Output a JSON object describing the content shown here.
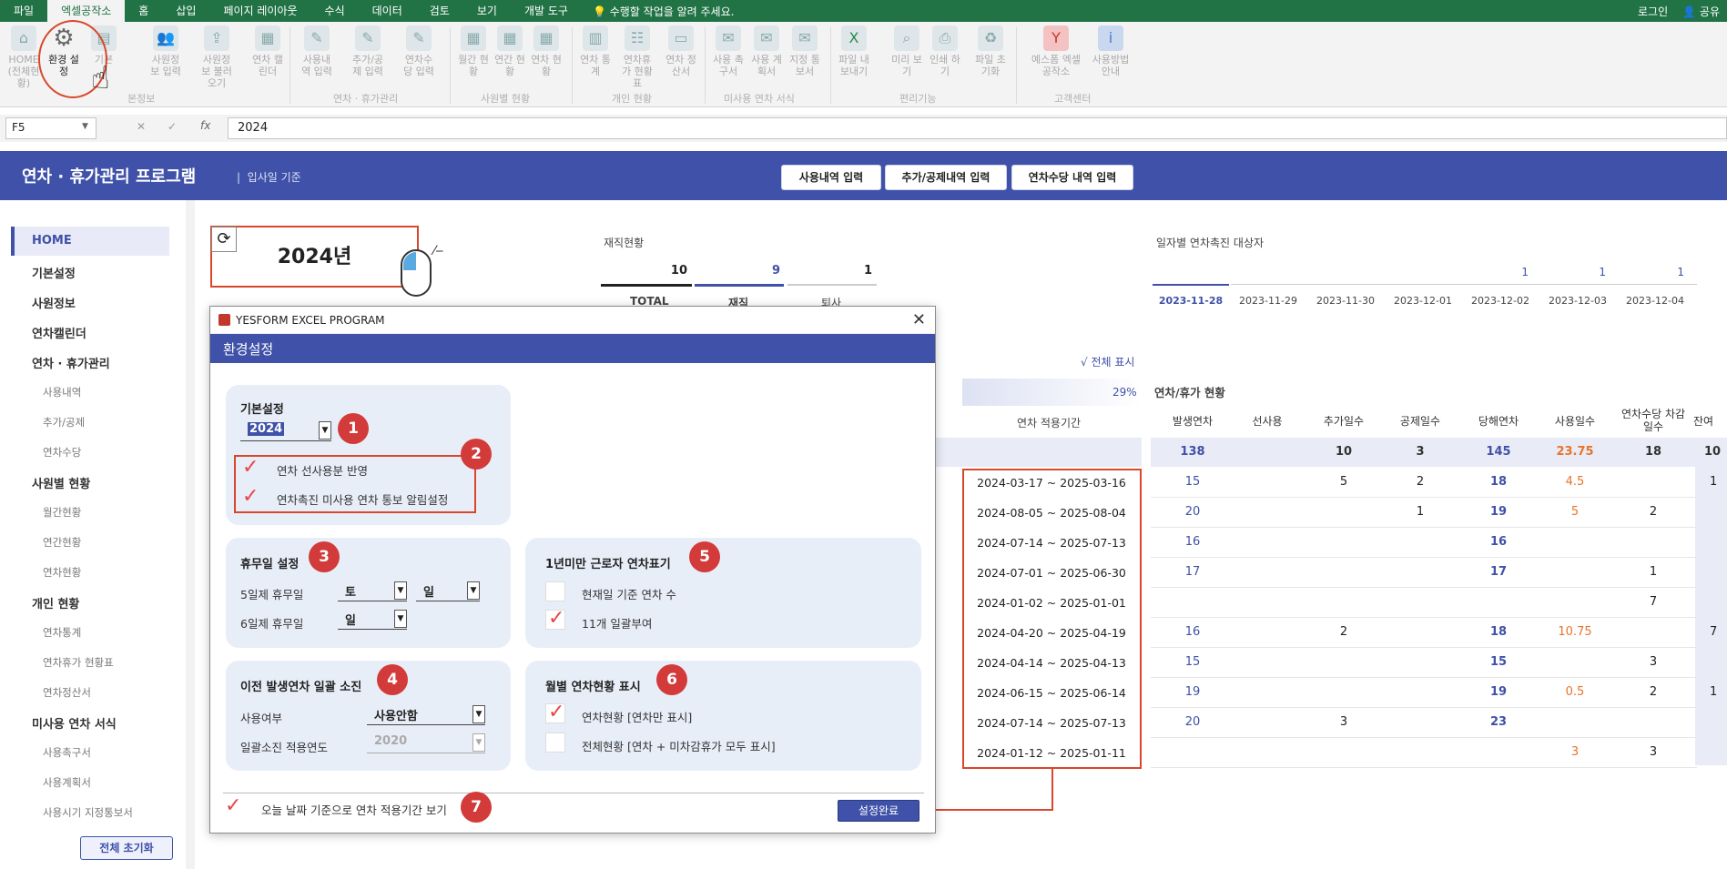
{
  "tabs": [
    "파일",
    "엑셀공작소",
    "홈",
    "삽입",
    "페이지 레이아웃",
    "수식",
    "데이터",
    "검토",
    "보기",
    "개발 도구"
  ],
  "tellme": "수행할 작업을 알려 주세요.",
  "login": "로그인",
  "share": "공유",
  "ribbon": {
    "buttons": [
      {
        "label": "HOME (전체현황)"
      },
      {
        "label": "환경 설정"
      },
      {
        "label": "기본"
      },
      {
        "label": "사원정보 입력"
      },
      {
        "label": "사원정보 불러오기"
      },
      {
        "label": "연차 캘린더"
      },
      {
        "label": "사용내역 입력"
      },
      {
        "label": "추가/공제 입력"
      },
      {
        "label": "연차수당 입력"
      },
      {
        "label": "월간 현황"
      },
      {
        "label": "연간 현황"
      },
      {
        "label": "연차 현황"
      },
      {
        "label": "연차 통계"
      },
      {
        "label": "연차휴가 현황표"
      },
      {
        "label": "연차 정산서"
      },
      {
        "label": "사용 촉구서"
      },
      {
        "label": "사용 계획서"
      },
      {
        "label": "지정 통보서"
      },
      {
        "label": "파일 내보내기"
      },
      {
        "label": "미리 보기"
      },
      {
        "label": "인쇄 하기"
      },
      {
        "label": "파일 초기화"
      },
      {
        "label": "예스폼 엑셀공작소"
      },
      {
        "label": "사용방법 안내"
      }
    ],
    "groups": [
      "본정보",
      "연차 · 휴가관리",
      "사원별 현황",
      "개인 현황",
      "미사용 연차 서식",
      "편리기능",
      "고객센터"
    ]
  },
  "formula": {
    "namebox": "F5",
    "value": "2024"
  },
  "app": {
    "title": "연차 · 휴가관리 프로그램",
    "subtitle": "입사일 기준",
    "buttons": [
      "사용내역 입력",
      "추가/공제내역 입력",
      "연차수당 내역 입력"
    ]
  },
  "sidebar": {
    "items": [
      {
        "label": "HOME",
        "kind": "main"
      },
      {
        "label": "기본설정",
        "kind": "main"
      },
      {
        "label": "사원정보",
        "kind": "main"
      },
      {
        "label": "연차캘린더",
        "kind": "main"
      },
      {
        "label": "연차 · 휴가관리",
        "kind": "main"
      },
      {
        "label": "사용내역",
        "kind": "sub"
      },
      {
        "label": "추가/공제",
        "kind": "sub"
      },
      {
        "label": "연차수당",
        "kind": "sub"
      },
      {
        "label": "사원별 현황",
        "kind": "main"
      },
      {
        "label": "월간현황",
        "kind": "sub"
      },
      {
        "label": "연간현황",
        "kind": "sub"
      },
      {
        "label": "연차현황",
        "kind": "sub"
      },
      {
        "label": "개인 현황",
        "kind": "main"
      },
      {
        "label": "연차통계",
        "kind": "sub"
      },
      {
        "label": "연차휴가 현황표",
        "kind": "sub"
      },
      {
        "label": "연차정산서",
        "kind": "sub"
      },
      {
        "label": "미사용 연차 서식",
        "kind": "main"
      },
      {
        "label": "사용촉구서",
        "kind": "sub"
      },
      {
        "label": "사용계획서",
        "kind": "sub"
      },
      {
        "label": "사용시기 지정통보서",
        "kind": "sub"
      }
    ],
    "reset": "전체 초기화"
  },
  "dashboard": {
    "year": "2024년",
    "employ_title": "재직현황",
    "employ": [
      {
        "value": "10",
        "label": "TOTAL"
      },
      {
        "value": "9",
        "label": "재직"
      },
      {
        "value": "1",
        "label": "퇴사"
      }
    ],
    "date_title": "일자별 연차촉진 대상자",
    "dates": [
      {
        "date": "2023-11-28",
        "count": ""
      },
      {
        "date": "2023-11-29",
        "count": ""
      },
      {
        "date": "2023-11-30",
        "count": ""
      },
      {
        "date": "2023-12-01",
        "count": "1"
      },
      {
        "date": "2023-12-02",
        "count": ""
      },
      {
        "date": "2023-12-03",
        "count": "1"
      },
      {
        "date": "2023-12-04",
        "count": "1"
      }
    ],
    "show_all": "√ 전체 표시",
    "progress": "29%",
    "period_header": "연차 적용기간",
    "leave_title": "연차/휴가 현황",
    "columns": [
      "발생연차",
      "선사용",
      "추가일수",
      "공제일수",
      "당해연차",
      "사용일수",
      "연차수당 차감일수",
      "잔여"
    ],
    "summary": [
      "138",
      "",
      "10",
      "3",
      "145",
      "23.75",
      "18",
      "10"
    ],
    "rows": [
      [
        "15",
        "",
        "5",
        "2",
        "18",
        "4.5",
        "",
        "1"
      ],
      [
        "20",
        "",
        "",
        "1",
        "19",
        "5",
        "2",
        ""
      ],
      [
        "16",
        "",
        "",
        "",
        "16",
        "",
        "",
        ""
      ],
      [
        "17",
        "",
        "",
        "",
        "17",
        "",
        "1",
        ""
      ],
      [
        "",
        "",
        "",
        "",
        "",
        "",
        "7",
        ""
      ],
      [
        "16",
        "",
        "2",
        "",
        "18",
        "10.75",
        "",
        "7"
      ],
      [
        "15",
        "",
        "",
        "",
        "15",
        "",
        "3",
        ""
      ],
      [
        "19",
        "",
        "",
        "",
        "19",
        "0.5",
        "2",
        "1"
      ],
      [
        "20",
        "",
        "3",
        "",
        "23",
        "",
        "",
        ""
      ],
      [
        "",
        "",
        "",
        "",
        "",
        "3",
        "3",
        ""
      ]
    ],
    "periods": [
      "2024-03-17 ~ 2025-03-16",
      "2024-08-05 ~ 2025-08-04",
      "2024-07-14 ~ 2025-07-13",
      "2024-07-01 ~ 2025-06-30",
      "2024-01-02 ~ 2025-01-01",
      "2024-04-20 ~ 2025-04-19",
      "2024-04-14 ~ 2025-04-13",
      "2024-06-15 ~ 2025-06-14",
      "2024-07-14 ~ 2025-07-13",
      "2024-01-12 ~ 2025-01-11"
    ]
  },
  "dialog": {
    "window_title": "YESFORM EXCEL PROGRAM",
    "header": "환경설정",
    "basic": {
      "title": "기본설정",
      "year": "2024",
      "opt1": "연차 선사용분 반영",
      "opt2": "연차촉진 미사용 연차 통보 알림설정"
    },
    "holiday": {
      "title": "휴무일 설정",
      "five_label": "5일제 휴무일",
      "five_v1": "토",
      "five_v2": "일",
      "six_label": "6일제 휴무일",
      "six_v": "일"
    },
    "under1": {
      "title": "1년미만 근로자 연차표기",
      "opt1": "현재일 기준 연차 수",
      "opt2": "11개 일괄부여"
    },
    "prev": {
      "title": "이전 발생연차 일괄 소진",
      "use_label": "사용여부",
      "use_value": "사용안함",
      "year_label": "일괄소진 적용연도",
      "year_value": "2020"
    },
    "monthly": {
      "title": "월별 연차현황 표시",
      "opt1": "연차현황 [연차만 표시]",
      "opt2": "전체현황 [연차 + 미차감휴가 모두 표시]"
    },
    "today_opt": "오늘 날짜 기준으로 연차 적용기간 보기",
    "ok": "설정완료",
    "badges": [
      "1",
      "2",
      "3",
      "4",
      "5",
      "6",
      "7"
    ]
  },
  "colors": {
    "excel_green": "#217346",
    "brand": "#3f51a8",
    "highlight": "#d9472b",
    "orange": "#e8742a"
  }
}
